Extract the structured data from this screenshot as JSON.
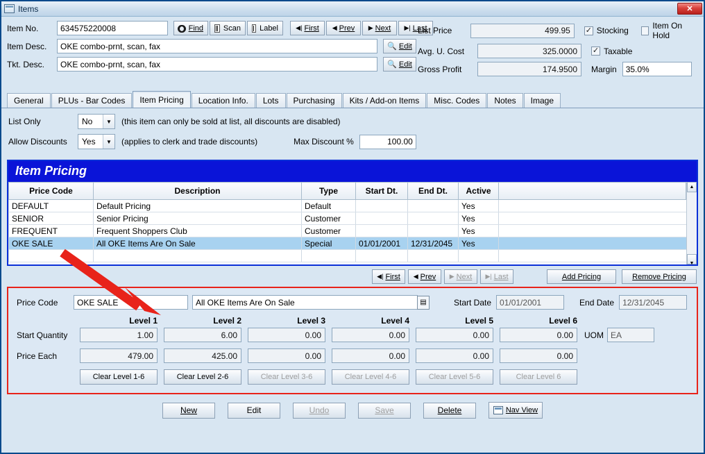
{
  "window": {
    "title": "Items",
    "close_label": "✕"
  },
  "header": {
    "item_no_label": "Item No.",
    "item_no_value": "634575220008",
    "item_desc_label": "Item Desc.",
    "item_desc_value": "OKE combo-prnt, scan, fax",
    "tkt_desc_label": "Tkt. Desc.",
    "tkt_desc_value": "OKE combo-prnt, scan, fax",
    "find_label": "Find",
    "scan_label": "Scan",
    "label_label": "Label",
    "first_label": "First",
    "prev_label": "Prev",
    "next_label": "Next",
    "last_label": "Last",
    "edit_label": "Edit",
    "list_price_label": "List Price",
    "list_price_value": "499.95",
    "avg_cost_label": "Avg. U. Cost",
    "avg_cost_value": "325.0000",
    "gross_profit_label": "Gross Profit",
    "gross_profit_value": "174.9500",
    "stocking_label": "Stocking",
    "stocking_checked": true,
    "item_on_hold_label": "Item On Hold",
    "item_on_hold_checked": false,
    "taxable_label": "Taxable",
    "taxable_checked": true,
    "margin_label": "Margin",
    "margin_value": "35.0%"
  },
  "tabs": [
    {
      "label": "General",
      "active": false
    },
    {
      "label": "PLUs - Bar Codes",
      "active": false
    },
    {
      "label": "Item Pricing",
      "active": true
    },
    {
      "label": "Location Info.",
      "active": false
    },
    {
      "label": "Lots",
      "active": false
    },
    {
      "label": "Purchasing",
      "active": false
    },
    {
      "label": "Kits / Add-on Items",
      "active": false
    },
    {
      "label": "Misc. Codes",
      "active": false
    },
    {
      "label": "Notes",
      "active": false
    },
    {
      "label": "Image",
      "active": false
    }
  ],
  "options": {
    "list_only_label": "List Only",
    "list_only_value": "No",
    "list_only_hint": "(this item can only be sold at list, all discounts are disabled)",
    "allow_discounts_label": "Allow Discounts",
    "allow_discounts_value": "Yes",
    "allow_discounts_hint": "(applies to clerk and trade discounts)",
    "max_discount_label": "Max Discount %",
    "max_discount_value": "100.00"
  },
  "grid": {
    "title": "Item Pricing",
    "columns": [
      "Price Code",
      "Description",
      "Type",
      "Start Dt.",
      "End Dt.",
      "Active",
      ""
    ],
    "rows": [
      {
        "code": "DEFAULT",
        "desc": "Default Pricing",
        "type": "Default",
        "start": "",
        "end": "",
        "active": "Yes",
        "selected": false
      },
      {
        "code": "SENIOR",
        "desc": "Senior Pricing",
        "type": "Customer",
        "start": "",
        "end": "",
        "active": "Yes",
        "selected": false
      },
      {
        "code": "FREQUENT",
        "desc": "Frequent Shoppers Club",
        "type": "Customer",
        "start": "",
        "end": "",
        "active": "Yes",
        "selected": false
      },
      {
        "code": "OKE SALE",
        "desc": "All OKE Items Are On Sale",
        "type": "Special",
        "start": "01/01/2001",
        "end": "12/31/2045",
        "active": "Yes",
        "selected": true
      }
    ],
    "nav": {
      "first": "First",
      "prev": "Prev",
      "next": "Next",
      "last": "Last",
      "add_pricing": "Add Pricing",
      "remove_pricing": "Remove Pricing"
    }
  },
  "detail": {
    "price_code_label": "Price Code",
    "price_code_value": "OKE SALE",
    "price_code_desc": "All OKE Items Are On Sale",
    "start_date_label": "Start Date",
    "start_date_value": "01/01/2001",
    "end_date_label": "End Date",
    "end_date_value": "12/31/2045",
    "level_headers": [
      "Level 1",
      "Level 2",
      "Level 3",
      "Level 4",
      "Level 5",
      "Level 6"
    ],
    "start_qty_label": "Start Quantity",
    "start_qty_values": [
      "1.00",
      "6.00",
      "0.00",
      "0.00",
      "0.00",
      "0.00"
    ],
    "price_each_label": "Price Each",
    "price_each_values": [
      "479.00",
      "425.00",
      "0.00",
      "0.00",
      "0.00",
      "0.00"
    ],
    "uom_label": "UOM",
    "uom_value": "EA",
    "clear_buttons": [
      {
        "label": "Clear Level 1-6",
        "disabled": false
      },
      {
        "label": "Clear Level 2-6",
        "disabled": false
      },
      {
        "label": "Clear Level 3-6",
        "disabled": true
      },
      {
        "label": "Clear Level 4-6",
        "disabled": true
      },
      {
        "label": "Clear Level 5-6",
        "disabled": true
      },
      {
        "label": "Clear Level 6",
        "disabled": true
      }
    ]
  },
  "footer": {
    "new": "New",
    "edit": "Edit",
    "undo": "Undo",
    "save": "Save",
    "delete": "Delete",
    "nav_view": "Nav View"
  },
  "colors": {
    "accent_blue": "#0a14d8",
    "selection": "#a8d2f0",
    "annotation_red": "#e8231a",
    "window_bg": "#dce8f4"
  }
}
